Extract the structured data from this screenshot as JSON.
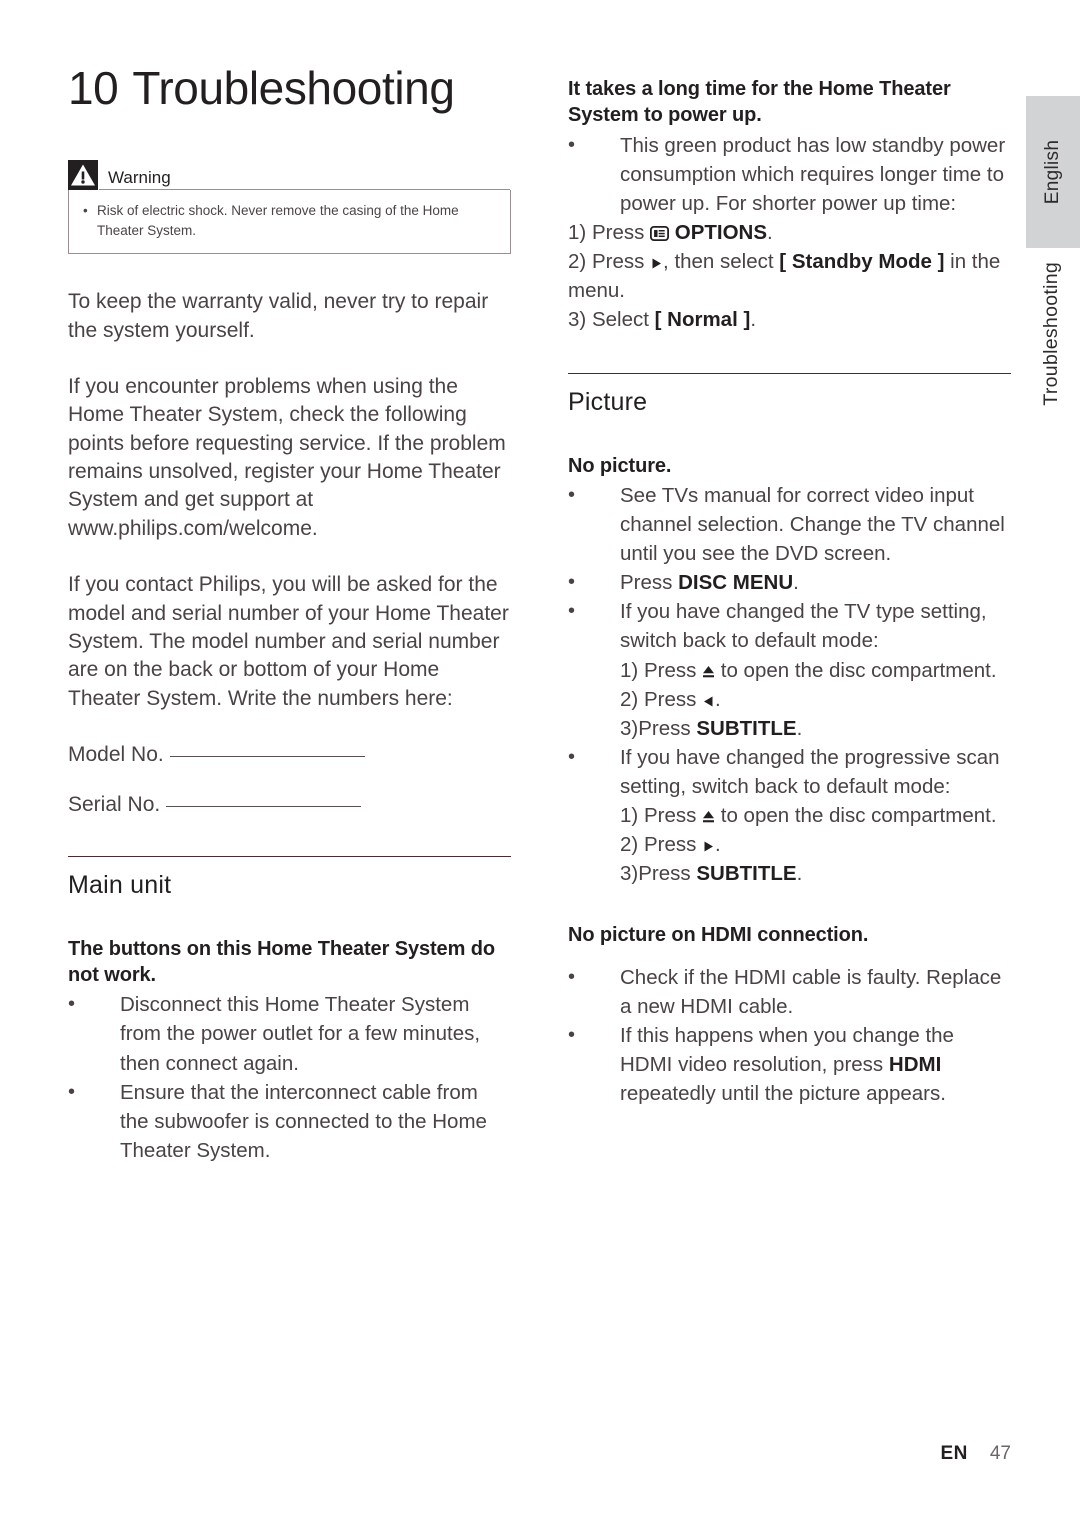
{
  "page": {
    "chapter_number": "10",
    "chapter_title": "Troubleshooting",
    "footer_locale": "EN",
    "footer_page": "47",
    "rule_color": "#4a2b2f",
    "tab_background": "#d2d3d5"
  },
  "side_tabs": {
    "language": "English",
    "section": "Troubleshooting"
  },
  "warning": {
    "icon": "warning-triangle-icon",
    "title": "Warning",
    "items": [
      "Risk of electric shock. Never remove the casing of the Home Theater System."
    ]
  },
  "left_column": {
    "paragraphs": [
      "To keep the warranty valid, never try to repair the system yourself.",
      "If you encounter problems when using the Home Theater System, check the following points before requesting service. If the problem remains unsolved, register your Home Theater System and get support at www.philips.com/welcome.",
      "If you contact Philips, you will be asked for the model and serial number of your Home Theater System. The model number and serial number are on the back or bottom of your Home Theater System. Write the numbers here:"
    ],
    "fill_in_fields": [
      {
        "label": "Model No."
      },
      {
        "label": "Serial No."
      }
    ],
    "section": {
      "title": "Main unit",
      "problems": [
        {
          "heading": "The buttons on this Home Theater System do not work.",
          "bullets": [
            "Disconnect this Home Theater System from the power outlet for a few minutes, then connect again.",
            "Ensure that the interconnect cable from the subwoofer is connected to the Home Theater System."
          ]
        }
      ]
    }
  },
  "right_column": {
    "power_up": {
      "heading": "It takes a long time for the Home Theater System to power up.",
      "bullet": "This green product has low standby power consumption which requires longer time to power up. For shorter power up time:",
      "steps": [
        {
          "num": "1)",
          "pre": "Press",
          "icon": "options-icon",
          "key": "OPTIONS",
          "post": "."
        },
        {
          "num": "2)",
          "pre": "Press",
          "icon": "arrow-right-icon",
          "mid": ", then select",
          "key": "[ Standby Mode ]",
          "post": " in the menu."
        },
        {
          "num": "3)",
          "pre": "Select",
          "key": "[ Normal ]",
          "post": "."
        }
      ]
    },
    "section": {
      "title": "Picture",
      "problems": [
        {
          "heading": "No picture.",
          "bullets": [
            {
              "text": "See TVs manual for correct video input channel selection. Change the TV channel until you see the DVD screen."
            },
            {
              "pre": "Press ",
              "key": "DISC MENU",
              "post": "."
            },
            {
              "text": "If you have changed the TV type setting, switch back to default mode:",
              "steps": [
                {
                  "num": "1)",
                  "pre": "Press",
                  "icon": "eject-icon",
                  "post": "to open the disc compartment."
                },
                {
                  "num": "2)",
                  "pre": "Press",
                  "icon": "arrow-left-icon",
                  "post": "."
                },
                {
                  "num": "3)",
                  "pre": "Press ",
                  "key": "SUBTITLE",
                  "post": "."
                }
              ]
            },
            {
              "text": "If you have changed the progressive scan setting, switch back to default mode:",
              "steps": [
                {
                  "num": "1)",
                  "pre": "Press",
                  "icon": "eject-icon",
                  "post": "to open the disc compartment."
                },
                {
                  "num": "2)",
                  "pre": "Press",
                  "icon": "arrow-right-icon",
                  "post": "."
                },
                {
                  "num": "3)",
                  "pre": "Press ",
                  "key": "SUBTITLE",
                  "post": "."
                }
              ]
            }
          ]
        },
        {
          "heading": "No picture on HDMI connection.",
          "bullets": [
            {
              "text": "Check if the HDMI cable is faulty. Replace a new HDMI cable."
            },
            {
              "pre": "If this happens when you change the HDMI video resolution, press ",
              "key": "HDMI",
              "post": " repeatedly until the picture appears."
            }
          ]
        }
      ]
    }
  }
}
